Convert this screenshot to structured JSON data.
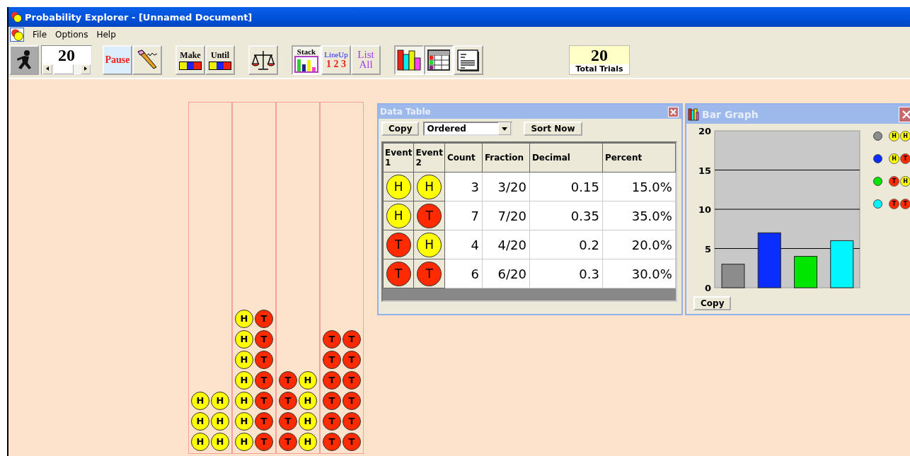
{
  "window": {
    "title": "Probability Explorer - [Unnamed Document]"
  },
  "menu": [
    "File",
    "Options",
    "Help"
  ],
  "toolbar": {
    "trials_field": {
      "value": "20"
    },
    "pause": {
      "label": "Pause"
    },
    "make": {
      "label": "Make"
    },
    "until": {
      "label": "Until"
    },
    "arrange": [
      {
        "kind": "stack",
        "label": "Stack",
        "selected": true
      },
      {
        "kind": "lineup",
        "label": "LineUp",
        "sublabel": "1 2 3",
        "selected": false
      },
      {
        "kind": "list",
        "label": "List",
        "sublabel": "All",
        "selected": false
      }
    ],
    "views": [
      {
        "kind": "bars",
        "on": true
      },
      {
        "kind": "table",
        "on": true
      },
      {
        "kind": "report",
        "on": false
      }
    ],
    "total": {
      "value": "20",
      "label": "Total Trials"
    }
  },
  "stacks": [
    {
      "pairs": [
        [
          {
            "label": "H",
            "kind": "heads"
          },
          {
            "label": "H",
            "kind": "heads"
          }
        ],
        [
          {
            "label": "H",
            "kind": "heads"
          },
          {
            "label": "H",
            "kind": "heads"
          }
        ],
        [
          {
            "label": "H",
            "kind": "heads"
          },
          {
            "label": "H",
            "kind": "heads"
          }
        ]
      ]
    },
    {
      "pairs": [
        [
          {
            "label": "H",
            "kind": "heads"
          },
          {
            "label": "T",
            "kind": "tails"
          }
        ],
        [
          {
            "label": "H",
            "kind": "heads"
          },
          {
            "label": "T",
            "kind": "tails"
          }
        ],
        [
          {
            "label": "H",
            "kind": "heads"
          },
          {
            "label": "T",
            "kind": "tails"
          }
        ],
        [
          {
            "label": "H",
            "kind": "heads"
          },
          {
            "label": "T",
            "kind": "tails"
          }
        ],
        [
          {
            "label": "H",
            "kind": "heads"
          },
          {
            "label": "T",
            "kind": "tails"
          }
        ],
        [
          {
            "label": "H",
            "kind": "heads"
          },
          {
            "label": "T",
            "kind": "tails"
          }
        ],
        [
          {
            "label": "H",
            "kind": "heads"
          },
          {
            "label": "T",
            "kind": "tails"
          }
        ]
      ]
    },
    {
      "pairs": [
        [
          {
            "label": "T",
            "kind": "tails"
          },
          {
            "label": "H",
            "kind": "heads"
          }
        ],
        [
          {
            "label": "T",
            "kind": "tails"
          },
          {
            "label": "H",
            "kind": "heads"
          }
        ],
        [
          {
            "label": "T",
            "kind": "tails"
          },
          {
            "label": "H",
            "kind": "heads"
          }
        ],
        [
          {
            "label": "T",
            "kind": "tails"
          },
          {
            "label": "H",
            "kind": "heads"
          }
        ]
      ]
    },
    {
      "pairs": [
        [
          {
            "label": "T",
            "kind": "tails"
          },
          {
            "label": "T",
            "kind": "tails"
          }
        ],
        [
          {
            "label": "T",
            "kind": "tails"
          },
          {
            "label": "T",
            "kind": "tails"
          }
        ],
        [
          {
            "label": "T",
            "kind": "tails"
          },
          {
            "label": "T",
            "kind": "tails"
          }
        ],
        [
          {
            "label": "T",
            "kind": "tails"
          },
          {
            "label": "T",
            "kind": "tails"
          }
        ],
        [
          {
            "label": "T",
            "kind": "tails"
          },
          {
            "label": "T",
            "kind": "tails"
          }
        ],
        [
          {
            "label": "T",
            "kind": "tails"
          },
          {
            "label": "T",
            "kind": "tails"
          }
        ]
      ]
    }
  ],
  "data_table": {
    "title": "Data Table",
    "copy": "Copy",
    "sort_mode": "Ordered",
    "sort_button": "Sort Now",
    "columns": [
      "Event 1",
      "Event 2",
      "Count",
      "Fraction",
      "Decimal",
      "Percent"
    ],
    "rows": [
      {
        "event_1": {
          "label": "H",
          "kind": "heads"
        },
        "event_2": {
          "label": "H",
          "kind": "heads"
        },
        "count": "3",
        "fraction": "3/20",
        "decimal": "0.15",
        "percent": "15.0%"
      },
      {
        "event_1": {
          "label": "H",
          "kind": "heads"
        },
        "event_2": {
          "label": "T",
          "kind": "tails"
        },
        "count": "7",
        "fraction": "7/20",
        "decimal": "0.35",
        "percent": "35.0%"
      },
      {
        "event_1": {
          "label": "T",
          "kind": "tails"
        },
        "event_2": {
          "label": "H",
          "kind": "heads"
        },
        "count": "4",
        "fraction": "4/20",
        "decimal": "0.2",
        "percent": "20.0%"
      },
      {
        "event_1": {
          "label": "T",
          "kind": "tails"
        },
        "event_2": {
          "label": "T",
          "kind": "tails"
        },
        "count": "6",
        "fraction": "6/20",
        "decimal": "0.3",
        "percent": "30.0%"
      }
    ]
  },
  "bar_graph": {
    "title": "Bar Graph",
    "copy": "Copy",
    "legend": [
      {
        "color": "#8c8c8c",
        "coins": [
          {
            "label": "H",
            "kind": "heads"
          },
          {
            "label": "H",
            "kind": "heads"
          }
        ]
      },
      {
        "color": "#0a2eff",
        "coins": [
          {
            "label": "H",
            "kind": "heads"
          },
          {
            "label": "T",
            "kind": "tails"
          }
        ]
      },
      {
        "color": "#00e600",
        "coins": [
          {
            "label": "T",
            "kind": "tails"
          },
          {
            "label": "H",
            "kind": "heads"
          }
        ]
      },
      {
        "color": "#00f5ff",
        "coins": [
          {
            "label": "T",
            "kind": "tails"
          },
          {
            "label": "T",
            "kind": "tails"
          }
        ]
      }
    ],
    "chart_data": {
      "type": "bar",
      "values": [
        3,
        7,
        4,
        6
      ],
      "ylim": [
        0,
        20
      ],
      "yticks": [
        0,
        5,
        10,
        15,
        20
      ],
      "grid": true
    }
  }
}
